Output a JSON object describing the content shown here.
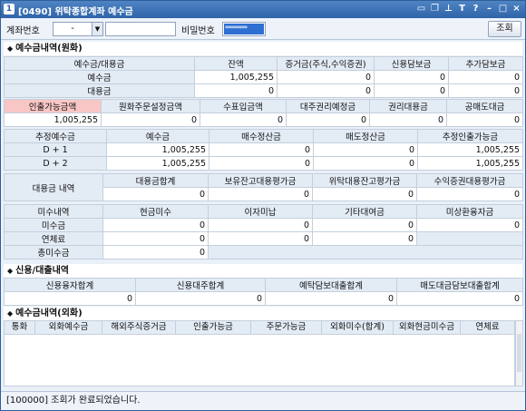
{
  "title": {
    "num": "1",
    "text": "[0490] 위탁종합계좌 예수금"
  },
  "title_icons": [
    "window-icon",
    "copy-icon",
    "pin-icon",
    "text-icon",
    "help-icon",
    "minimize-icon",
    "maximize-icon",
    "close-icon"
  ],
  "toolbar": {
    "account_label": "계좌번호",
    "account_value": "-",
    "password_label": "비밀번호",
    "password_mask": "********",
    "search_button": "조회"
  },
  "sections": {
    "deposit": "예수금내역(원화)",
    "credit": "신용/대출내역",
    "foreign": "예수금내역(외화)"
  },
  "deposit": {
    "hdr": [
      "예수금/대용금",
      "잔액",
      "증거금(주식,수익증권)",
      "신용담보금",
      "추가담보금"
    ],
    "rows": [
      {
        "label": "예수금",
        "vals": [
          "1,005,255",
          "0",
          "0",
          "0"
        ]
      },
      {
        "label": "대용금",
        "vals": [
          "0",
          "0",
          "0",
          "0"
        ]
      }
    ],
    "hdr2": [
      "인출가능금액",
      "원화주문설정금액",
      "수표입금액",
      "대주권리예정금",
      "권리대용금",
      "공매도대금"
    ],
    "vals2": [
      "1,005,255",
      "0",
      "0",
      "0",
      "0",
      "0"
    ]
  },
  "settle": {
    "hdr": [
      "추정예수금",
      "예수금",
      "매수정산금",
      "매도정산금",
      "추정인출가능금"
    ],
    "rows": [
      {
        "label": "D + 1",
        "vals": [
          "1,005,255",
          "0",
          "0",
          "1,005,255"
        ]
      },
      {
        "label": "D + 2",
        "vals": [
          "1,005,255",
          "0",
          "0",
          "1,005,255"
        ]
      }
    ]
  },
  "substitute": {
    "label": "대용금 내역",
    "hdr": [
      "대용금합계",
      "보유잔고대용평가금",
      "위탁대용잔고평가금",
      "수익증권대용평가금"
    ],
    "vals": [
      "0",
      "0",
      "0",
      "0"
    ]
  },
  "unpaid": {
    "hdr": [
      "미수내역",
      "현금미수",
      "이자미납",
      "기타대여금",
      "미상환융자금"
    ],
    "rows": [
      {
        "label": "미수금",
        "vals": [
          "0",
          "0",
          "0",
          "0"
        ]
      },
      {
        "label": "연체료",
        "vals": [
          "0",
          "0",
          "0"
        ]
      },
      {
        "label": "총미수금",
        "vals": [
          "0"
        ]
      }
    ]
  },
  "credit": {
    "hdr": [
      "신용융자합계",
      "신용대주합계",
      "예탁담보대출합계",
      "매도대금담보대출합계"
    ],
    "vals": [
      "0",
      "0",
      "0",
      "0"
    ]
  },
  "foreign": {
    "cols": [
      "통화",
      "외화예수금",
      "해외주식증거금",
      "인출가능금",
      "주문가능금",
      "외화미수(합계)",
      "외화현금미수금",
      "연체료"
    ]
  },
  "status": "[100000] 조회가 완료되었습니다."
}
